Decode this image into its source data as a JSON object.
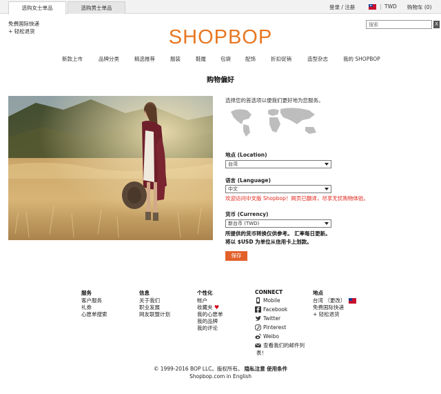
{
  "tabs": [
    "选购女士单品",
    "选购男士单品"
  ],
  "account": {
    "login": "登录 / 注册",
    "separator": "|",
    "currency": "TWD",
    "cart": "购物车 (0)"
  },
  "promos": [
    "免费国际快递",
    "+ 轻松退货"
  ],
  "search": {
    "placeholder": "搜索",
    "close": "X"
  },
  "logo": "SHOPBOP",
  "nav": [
    "新款上市",
    "品牌分类",
    "精选推荐",
    "服装",
    "鞋履",
    "包袋",
    "配饰",
    "折扣促销",
    "造型杂志",
    "我的 SHOPBOP"
  ],
  "page_title": "购物偏好",
  "prefs": {
    "intro": "选择您的首选项以便我们更好地为您服务。",
    "location_label": "地点 (Location)",
    "location_value": "台湾",
    "language_label": "语言 (Language)",
    "language_value": "中文",
    "language_warning": "欢迎访问中文版 Shopbop！网页已翻译，尽享无忧购物体验。",
    "currency_label": "货币 (Currency)",
    "currency_value": "新台币 (TWD)",
    "note_1": "所提供的货币转换仅供参考。 汇率每日更新。",
    "note_2": "将以 $USD 为单位从信用卡上划款。",
    "save": "保存"
  },
  "footer": {
    "service": {
      "title": "服务",
      "links": [
        "客户服务",
        "礼券",
        "心愿单搜索"
      ]
    },
    "info": {
      "title": "信息",
      "links": [
        "关于我们",
        "职业发展",
        "网友联盟计划"
      ]
    },
    "personal": {
      "title": "个性化",
      "links": [
        "帐户",
        "收藏夹",
        "我的心愿单",
        "我的品牌",
        "我的评论"
      ]
    },
    "connect": {
      "title": "CONNECT",
      "links": [
        "Mobile",
        "Facebook",
        "Twitter",
        "Pinterest",
        "Weibo",
        "查看我们的邮件列",
        "表！"
      ]
    },
    "location": {
      "title": "地点",
      "links": [
        "台湾 （更改）",
        "免费国际快递",
        "+ 轻松退货"
      ]
    }
  },
  "copyright": {
    "prefix": "© 1999-2016 BOP LLC。版权所有。",
    "privacy": "隐私注意",
    "terms": "使用条件"
  },
  "english_link": "Shopbop.com in English",
  "colors": {
    "accent": "#e87722",
    "button": "#e2612a",
    "warning": "#e2231a"
  }
}
